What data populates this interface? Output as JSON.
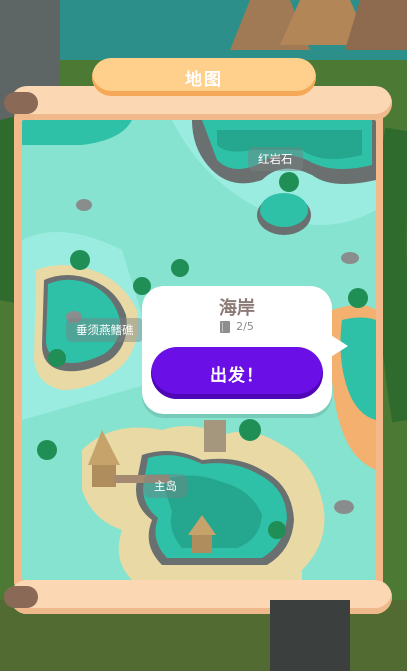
{
  "header": {
    "title": "地图"
  },
  "map": {
    "locations": [
      {
        "name": "红岩石"
      },
      {
        "name": "垂须燕鳍礁"
      },
      {
        "name": "主岛"
      }
    ]
  },
  "popup": {
    "title": "海岸",
    "progress": "2/5",
    "go_label": "出发！"
  },
  "colors": {
    "water": "#85e3cf",
    "scroll": "#fcd7b4",
    "title_pill": "#ffcf8c",
    "button": "#6a0fe6"
  }
}
